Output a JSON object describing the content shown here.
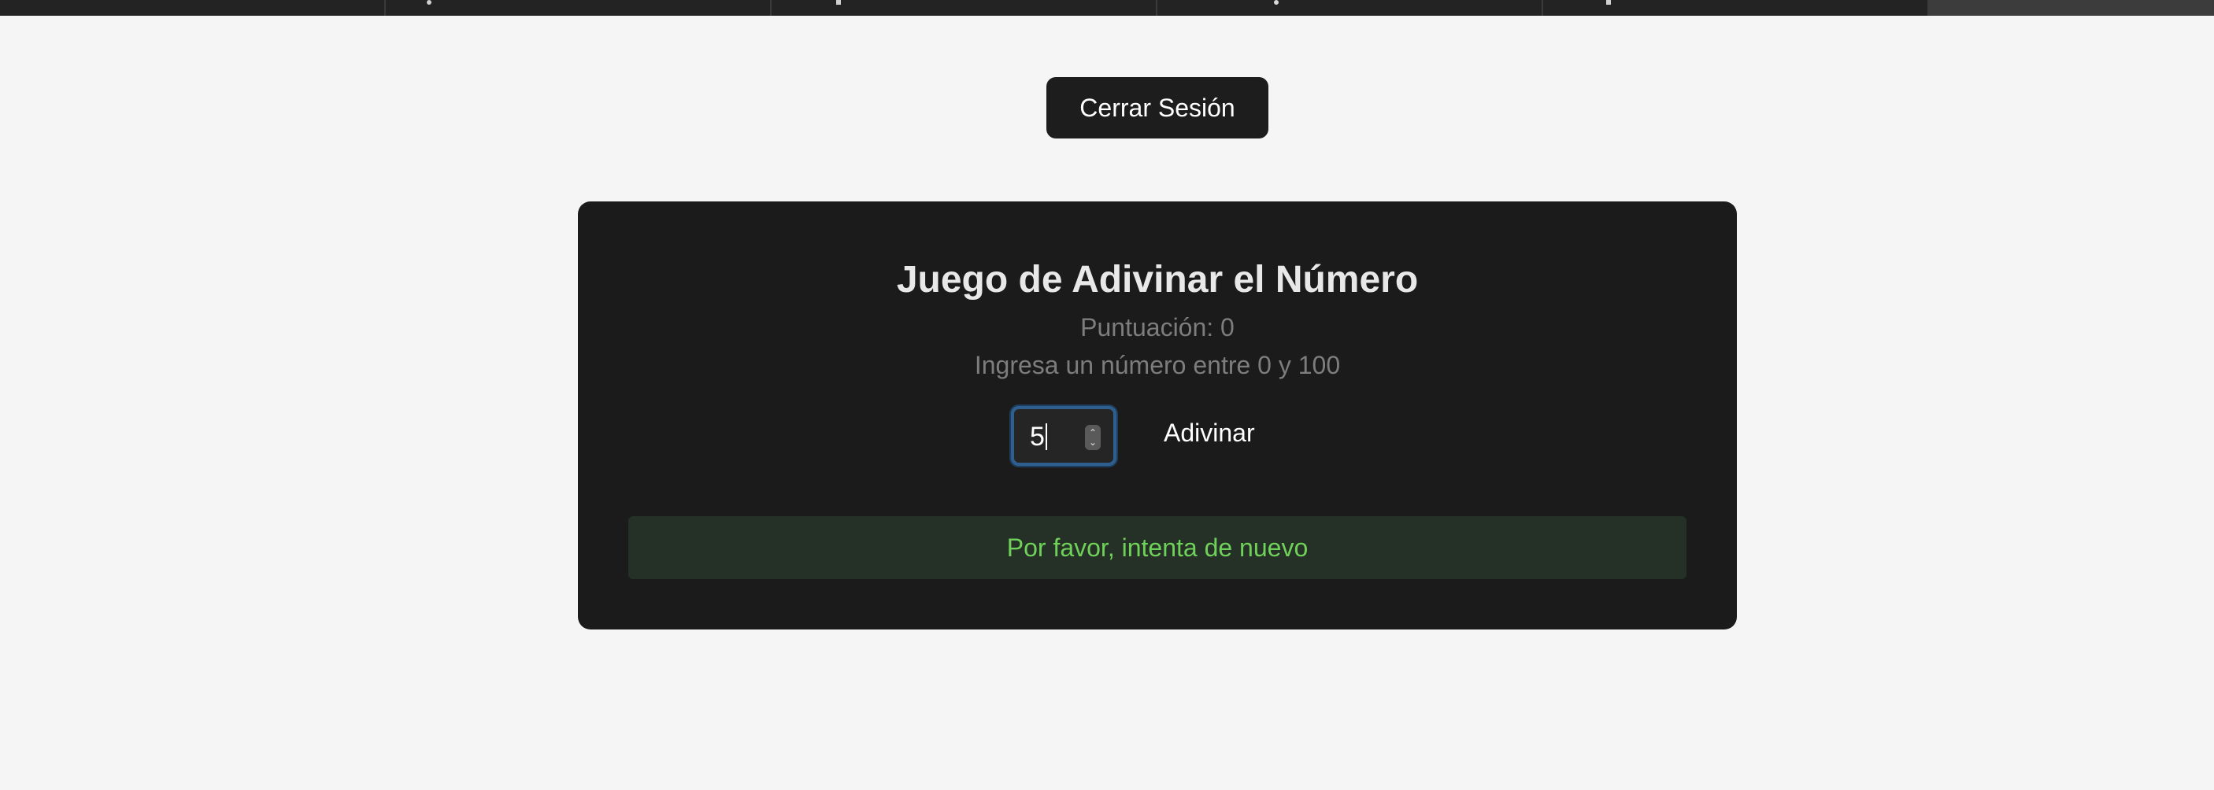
{
  "browser": {
    "tabs": [
      {
        "icon": "folder-icon"
      },
      {
        "icon": "circle-icon"
      },
      {
        "icon": "square-icon"
      },
      {
        "icon": "green-circle-icon"
      },
      {
        "icon": "square-icon"
      },
      {
        "icon": "grey-square-icon",
        "active": true
      }
    ]
  },
  "header": {
    "logout_label": "Cerrar Sesión"
  },
  "game": {
    "title": "Juego de Adivinar el Número",
    "score_text": "Puntuación: 0",
    "instruction": "Ingresa un número entre 0 y 100",
    "input_value": "5",
    "guess_label": "Adivinar",
    "feedback": "Por favor, intenta de nuevo"
  },
  "colors": {
    "page_background": "#f5f5f5",
    "card_background": "#1b1b1b",
    "feedback_text": "#6fd15a",
    "feedback_background": "#253026",
    "input_focus_border": "#2f5f8f"
  }
}
